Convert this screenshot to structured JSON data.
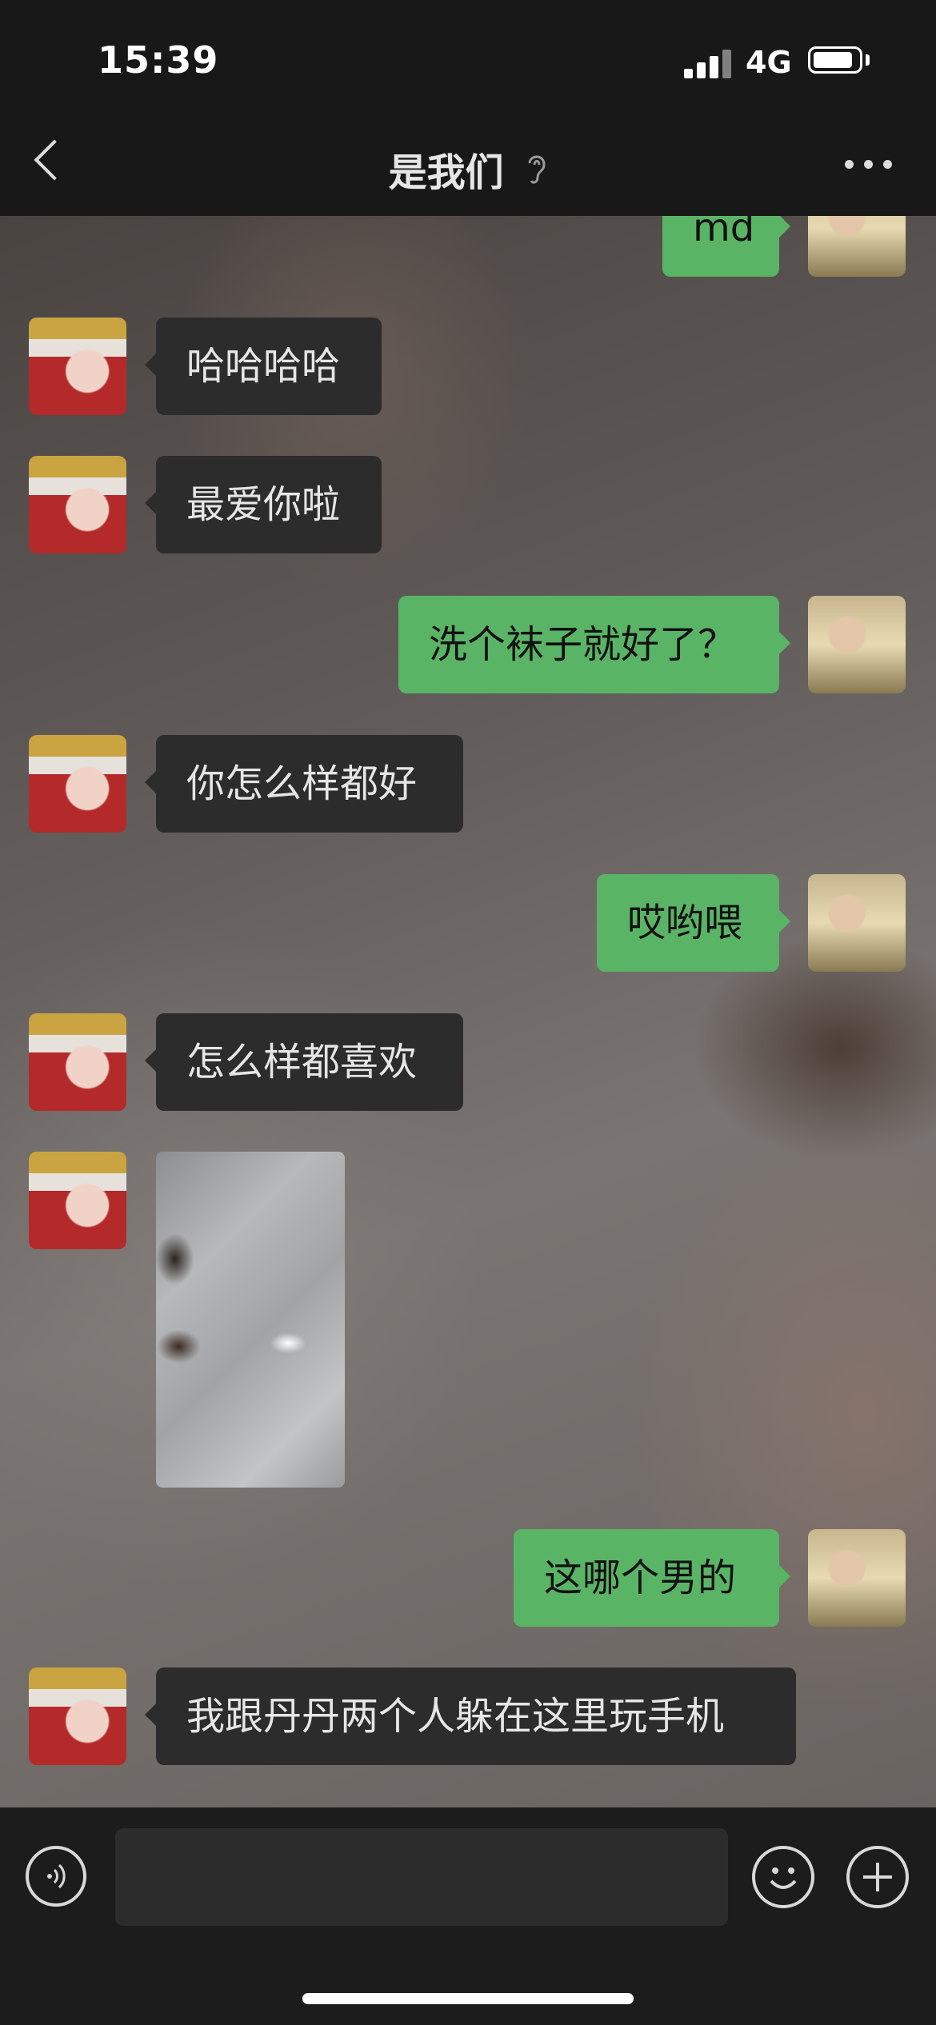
{
  "status_bar": {
    "time": "15:39",
    "network": "4G",
    "signal_icon": "cellular-signal-icon",
    "battery_icon": "battery-icon"
  },
  "header": {
    "title": "是我们",
    "title_icon": "ear-icon",
    "back_icon": "chevron-left-icon",
    "more_icon": "more-dots-icon"
  },
  "messages": [
    {
      "sender": "self",
      "text": "md"
    },
    {
      "sender": "other",
      "text": "哈哈哈哈"
    },
    {
      "sender": "other",
      "text": "最爱你啦"
    },
    {
      "sender": "self",
      "text": "洗个袜子就好了？"
    },
    {
      "sender": "other",
      "text": "你怎么样都好"
    },
    {
      "sender": "self",
      "text": "哎哟喂"
    },
    {
      "sender": "other",
      "text": "怎么样都喜欢"
    },
    {
      "sender": "other",
      "type": "image",
      "image": "photo of shoes on tiled floor"
    },
    {
      "sender": "self",
      "text": "这哪个男的"
    },
    {
      "sender": "other",
      "text": "我跟丹丹两个人躲在这里玩手机"
    }
  ],
  "input_bar": {
    "voice_icon": "voice-icon",
    "input_value": "",
    "emoji_icon": "emoji-icon",
    "plus_icon": "plus-icon"
  },
  "colors": {
    "outgoing_bubble": "#5ab466",
    "incoming_bubble": "#2c2c2c",
    "bar_background": "#1c1c1c"
  }
}
